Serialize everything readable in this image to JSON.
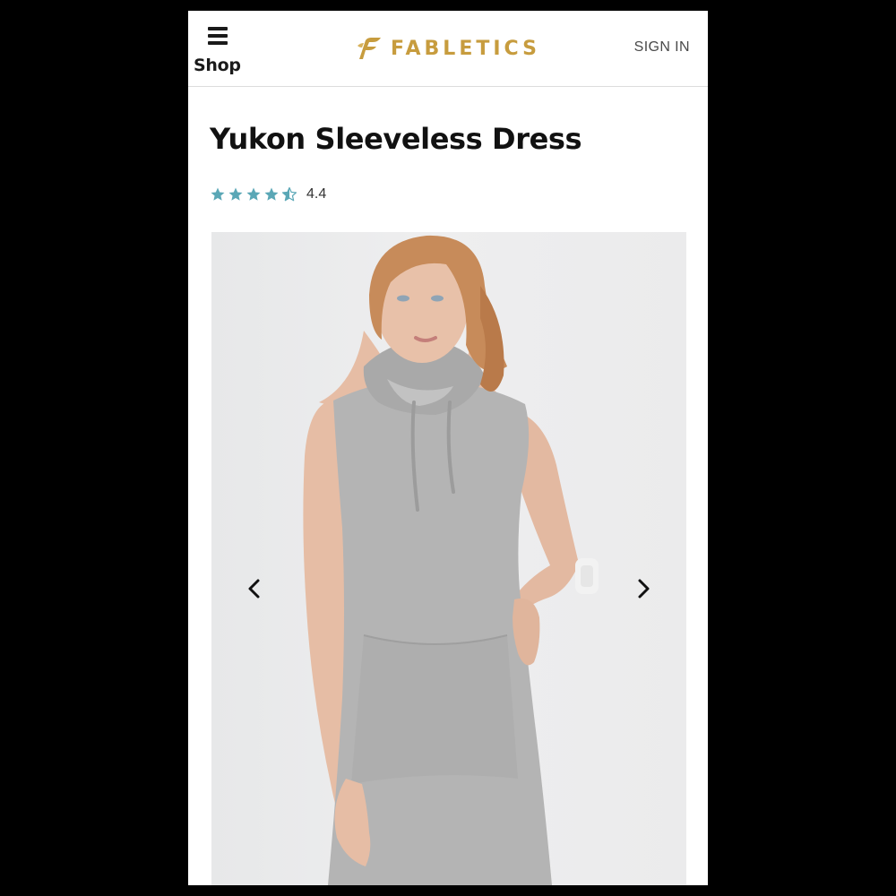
{
  "header": {
    "menu_label": "Shop",
    "brand": "FABLETICS",
    "signin_label": "SIGN IN"
  },
  "product": {
    "title": "Yukon Sleeveless Dress",
    "rating": 4.4,
    "rating_label": "4.4",
    "stars_full": 4,
    "stars_half": 1
  },
  "carousel": {
    "prev_icon": "chevron-left-icon",
    "next_icon": "chevron-right-icon"
  },
  "colors": {
    "brand_gold": "#c79c3e",
    "star_teal": "#5aa7b6",
    "dress_gray": "#b4b4b4"
  }
}
